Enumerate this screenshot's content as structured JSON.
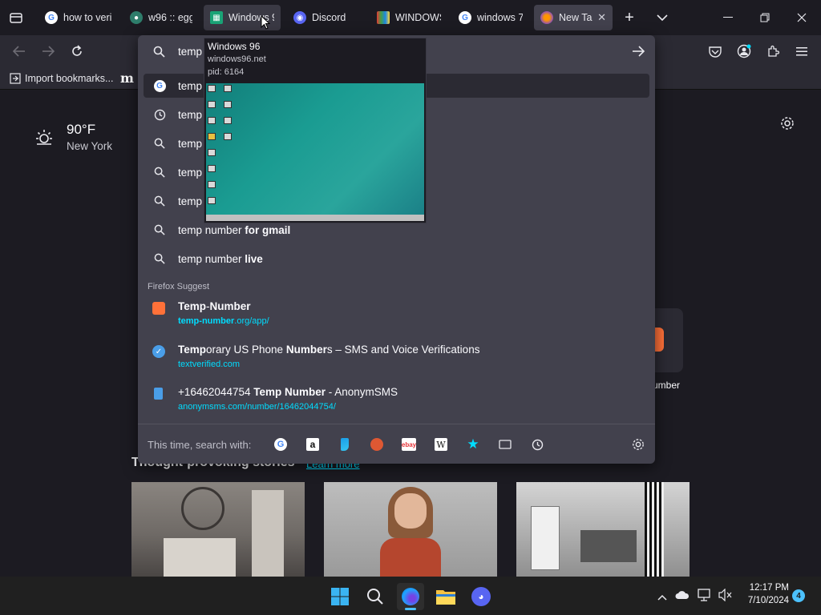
{
  "tabs": [
    {
      "title": "how to veri",
      "favicon": "google-g",
      "state": "normal"
    },
    {
      "title": "w96 :: egg.",
      "favicon": "globe",
      "state": "normal"
    },
    {
      "title": "Windows 9",
      "favicon": "windows96",
      "state": "hover"
    },
    {
      "title": "Discord",
      "favicon": "discord",
      "state": "normal"
    },
    {
      "title": "WINDOWS",
      "favicon": "windows-colored",
      "state": "normal"
    },
    {
      "title": "windows 7",
      "favicon": "google-g",
      "state": "normal"
    },
    {
      "title": "New Tab",
      "favicon": "firefox",
      "state": "active",
      "close": "✕"
    }
  ],
  "urlbar": {
    "query": "temp",
    "go_icon": "arrow-right-icon"
  },
  "bookmarks": {
    "import_label": "Import bookmarks...",
    "m_label": "m"
  },
  "tooltip": {
    "title": "Windows 96",
    "url": "windows96.net",
    "pid": "pid: 6164"
  },
  "suggestions": [
    {
      "prefix": "temp",
      "suffix": "",
      "icon": "google-g",
      "selected": true
    },
    {
      "prefix": "temp",
      "suffix": "",
      "icon": "history-clock",
      "selected": false
    },
    {
      "prefix": "temp",
      "suffix": "",
      "icon": "search",
      "selected": false
    },
    {
      "prefix": "temp",
      "suffix": "",
      "icon": "search",
      "selected": false
    },
    {
      "prefix": "temp",
      "suffix": "",
      "icon": "search",
      "selected": false
    },
    {
      "prefix": "temp number ",
      "suffix": "for gmail",
      "icon": "search",
      "selected": false
    },
    {
      "prefix": "temp number ",
      "suffix": "live",
      "icon": "search",
      "selected": false
    }
  ],
  "firefox_suggest": {
    "heading": "Firefox Suggest",
    "items": [
      {
        "title_bold": "Temp",
        "title_dash": "-",
        "title_bold2": "Number",
        "title_rest": "",
        "url_bold": "temp-number",
        "url_rest": ".org/app/",
        "icon": "temp-number-logo"
      },
      {
        "title_bold": "Temp",
        "title_dash": "orary US Phone ",
        "title_bold2": "Number",
        "title_rest": "s – SMS and Voice Verifications",
        "url_bold": "",
        "url_rest": "textverified.com",
        "icon": "check-badge"
      },
      {
        "title_bold": "",
        "title_dash": "+16462044754 ",
        "title_bold2": "Temp Number",
        "title_rest": " - AnonymSMS",
        "url_bold": "",
        "url_rest": "anonymsms.com/number/16462044754/",
        "icon": "phone"
      }
    ]
  },
  "search_with": {
    "label": "This time, search with:",
    "engines": [
      "google",
      "amazon",
      "bing",
      "duckduckgo",
      "ebay",
      "wikipedia",
      "bookmarks-star",
      "tabs",
      "history"
    ]
  },
  "weather": {
    "temp": "90°F",
    "location": "New York"
  },
  "stories": {
    "heading": "Thought-provoking stories",
    "learn_more": "Learn more"
  },
  "shortcut_partial": {
    "label": "umber"
  },
  "clock": {
    "time": "12:17 PM",
    "date": "7/10/2024",
    "notif_count": "4"
  },
  "colors": {
    "accent_cyan": "#00ddff",
    "panel_bg": "#42414d",
    "page_bg": "#1c1b22"
  }
}
